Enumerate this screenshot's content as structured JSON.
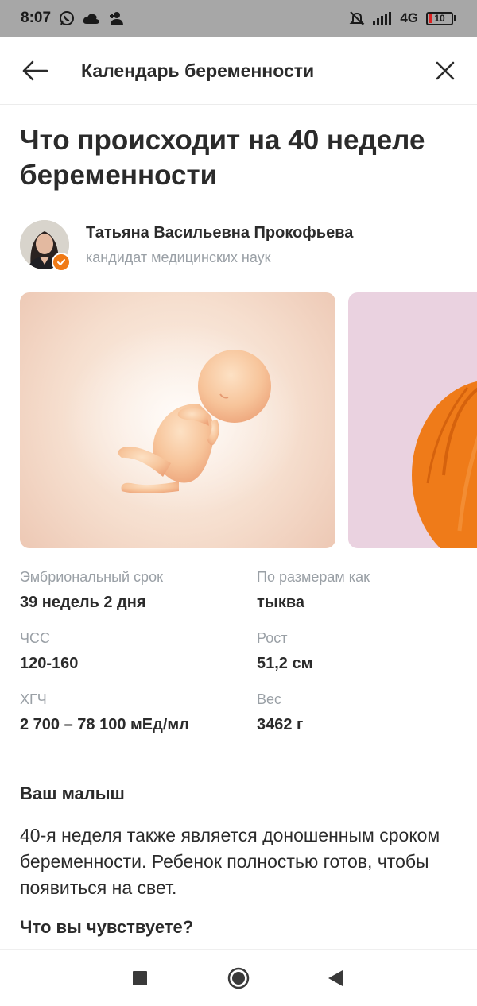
{
  "status_bar": {
    "time": "8:07",
    "network": "4G",
    "battery": "10",
    "icons": [
      "whatsapp-icon",
      "cloud-icon",
      "person-add-icon",
      "mute-bell-icon",
      "signal-icon",
      "battery-icon"
    ]
  },
  "header": {
    "title": "Календарь беременности",
    "back_icon": "arrow-left-icon",
    "close_icon": "close-icon"
  },
  "article": {
    "title": "Что происходит на 40 неделе беременности"
  },
  "author": {
    "name": "Татьяна Васильевна Прокофьева",
    "role": "кандидат медицинских наук",
    "badge_icon": "verified-check-icon"
  },
  "carousel": {
    "images": [
      "embryo-illustration",
      "pumpkin-image"
    ]
  },
  "stats": [
    {
      "label": "Эмбриональный срок",
      "value": "39 недель 2 дня"
    },
    {
      "label": "По размерам как",
      "value": "тыква"
    },
    {
      "label": "ЧСС",
      "value": "120-160"
    },
    {
      "label": "Рост",
      "value": "51,2 см"
    },
    {
      "label": "ХГЧ",
      "value": "2 700 – 78 100 мЕд/мл"
    },
    {
      "label": "Вес",
      "value": "3462 г"
    }
  ],
  "sections": {
    "baby_heading": "Ваш малыш",
    "baby_text": "40-я неделя также является доношенным сроком беременности. Ребенок полностью готов, чтобы появиться на свет.",
    "feel_heading": "Что вы чувствуете?"
  },
  "nav": {
    "icons": [
      "square-recents-icon",
      "circle-home-icon",
      "triangle-back-icon"
    ]
  },
  "colors": {
    "accent": "#f07a16",
    "statusbar": "#a7a7a7",
    "muted_text": "#9aa0a6",
    "fruit_card_bg": "#ead2e0"
  }
}
